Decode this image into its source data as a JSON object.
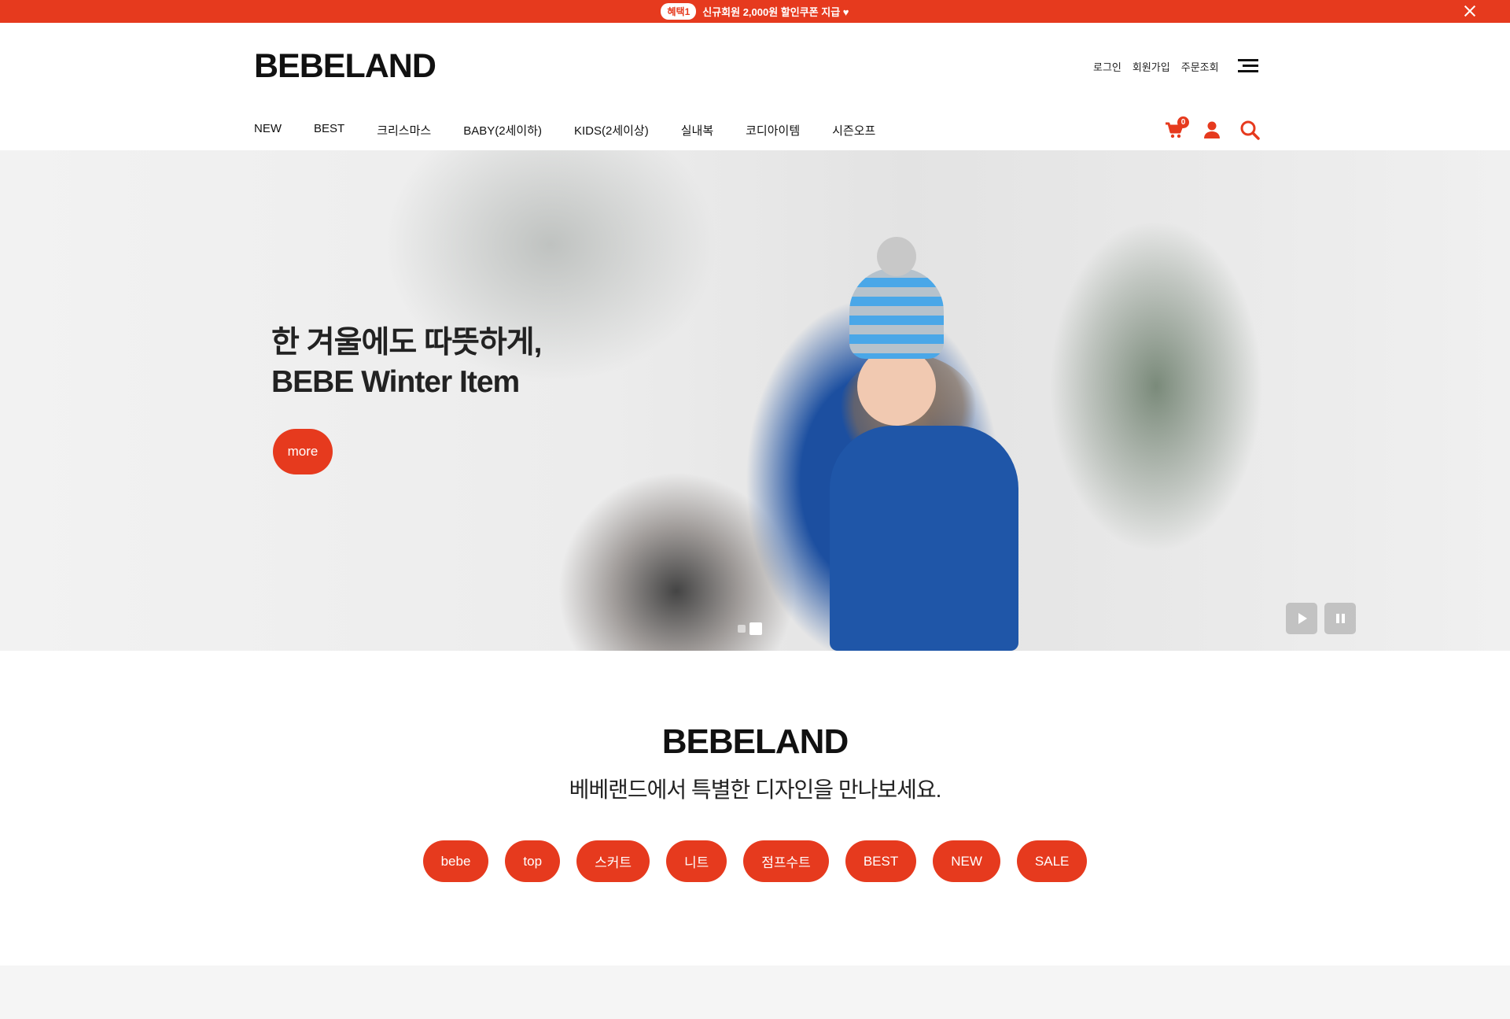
{
  "topbar": {
    "badge": "혜택1",
    "message": "신규회원 2,000원 할인쿠폰 지급 ♥"
  },
  "header": {
    "logo": "BEBELAND",
    "util": [
      "로그인",
      "회원가입",
      "주문조회"
    ],
    "cart_count": "0"
  },
  "gnb": [
    "NEW",
    "BEST",
    "크리스마스",
    "BABY(2세이하)",
    "KIDS(2세이상)",
    "실내복",
    "코디아이템",
    "시즌오프"
  ],
  "hero": {
    "line1": "한 겨울에도 따뜻하게,",
    "line2": "BEBE Winter Item",
    "button": "more"
  },
  "brand": {
    "title": "BEBELAND",
    "subtitle": "베베랜드에서 특별한 디자인을 만나보세요.",
    "tags": [
      "bebe",
      "top",
      "스커트",
      "니트",
      "점프수트",
      "BEST",
      "NEW",
      "SALE"
    ]
  },
  "colors": {
    "accent": "#e63a1e",
    "text": "#111111"
  },
  "icons": [
    "close-icon",
    "menu-icon",
    "cart-icon",
    "user-icon",
    "search-icon",
    "play-icon",
    "pause-icon"
  ]
}
